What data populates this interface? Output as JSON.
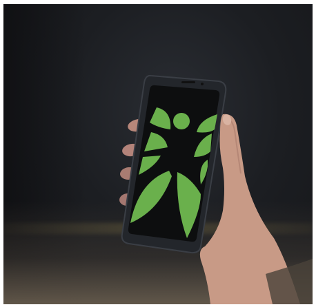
{
  "image": {
    "subject": "hand-holding-smartphone",
    "logo": "green-butterfly-figure-logo",
    "colors": {
      "logo_green": "#6ab04c",
      "screen": "#0d0e0f",
      "phone_body": "#23262b",
      "skin": "#c89a86",
      "background": "#1c1e22"
    }
  }
}
